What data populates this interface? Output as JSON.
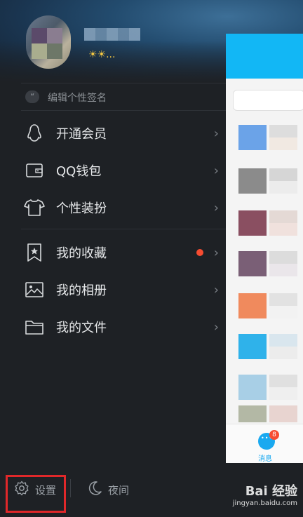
{
  "profile": {
    "level_icons": "☀☀..."
  },
  "signature": {
    "placeholder": "编辑个性签名"
  },
  "menu_primary": [
    {
      "label": "开通会员",
      "icon": "penguin-icon"
    },
    {
      "label": "QQ钱包",
      "icon": "wallet-icon"
    },
    {
      "label": "个性装扮",
      "icon": "tshirt-icon"
    }
  ],
  "menu_secondary": [
    {
      "label": "我的收藏",
      "icon": "bookmark-star-icon",
      "has_dot": true
    },
    {
      "label": "我的相册",
      "icon": "photo-album-icon"
    },
    {
      "label": "我的文件",
      "icon": "folder-icon"
    }
  ],
  "bottom_bar": {
    "settings_label": "设置",
    "night_label": "夜间"
  },
  "chat_panel": {
    "tab_label": "消息",
    "badge_count": "8"
  },
  "watermark": {
    "brand": "Bai 经验",
    "url": "jingyan.baidu.com"
  },
  "colors": {
    "drawer_bg": "#1e2125",
    "accent_blue": "#12b7f5",
    "highlight_red": "#e0282a",
    "notification_red": "#f74c31"
  }
}
